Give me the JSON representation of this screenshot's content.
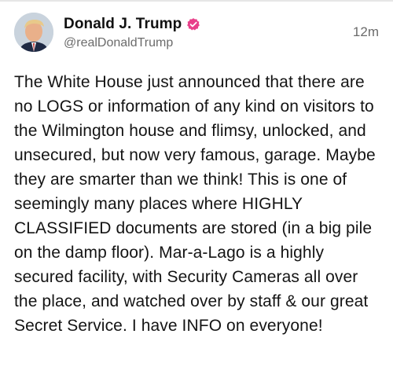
{
  "post": {
    "author": {
      "display_name": "Donald J. Trump",
      "handle": "@realDonaldTrump",
      "verified_icon": "verified-badge-icon"
    },
    "timestamp": "12m",
    "body": "The White House just announced that there are no LOGS or information of any kind on visitors to the Wilmington house and flimsy, unlocked, and unsecured, but now very famous, garage. Maybe they are smarter than we think! This is one of seemingly many places where HIGHLY CLASSIFIED documents are stored (in a big pile on the damp floor). Mar-a-Lago is a highly secured facility, with Security Cameras all over the place, and watched over by staff & our great Secret Service. I have INFO on everyone!"
  },
  "colors": {
    "verified_badge": "#e8408a",
    "secondary_text": "#6b6b6b",
    "primary_text": "#141414"
  }
}
